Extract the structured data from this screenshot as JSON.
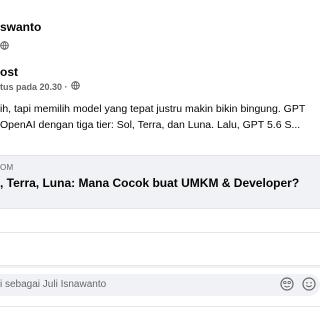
{
  "post": {
    "author_visible": "swanto",
    "privacy_icon": "globe-icon"
  },
  "shared_post": {
    "author_visible": "ost",
    "meta_visible": "tus pada 20.30 ·",
    "privacy_icon": "globe-icon",
    "text_line1": "ih, tapi memilih model yang tepat justru makin bikin bingung. GPT",
    "text_line2": "OpenAI dengan tiga tier: Sol, Terra, dan Luna. Lalu, GPT 5.6 S..."
  },
  "link_preview": {
    "domain_visible": "OM",
    "title_visible": ", Terra, Luna: Mana Cocok buat UMKM & Developer?"
  },
  "comment_box": {
    "placeholder_visible": "i sebagai Juli Isnawanto",
    "emoji_icon": "emoji-icon",
    "sticker_icon": "sticker-icon"
  }
}
